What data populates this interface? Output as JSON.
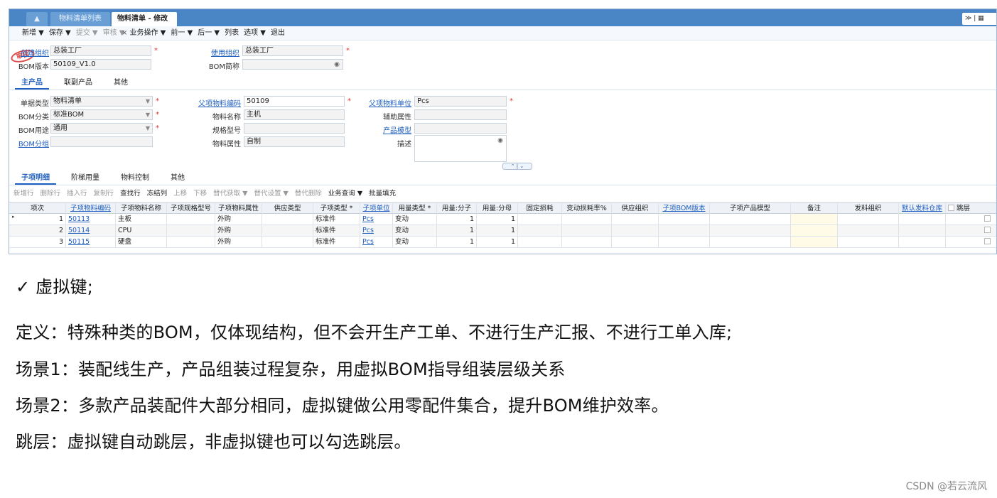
{
  "tabs": {
    "home_icon": "home-icon",
    "list": "物料清单列表",
    "active": "物料清单 - 修改",
    "close": "×",
    "right_tools": "≫ | ▦"
  },
  "toolbar": {
    "items": [
      {
        "label": "新增 ▼",
        "disabled": false
      },
      {
        "label": "保存 ▼",
        "disabled": false
      },
      {
        "label": "提交 ▼",
        "disabled": true
      },
      {
        "label": "审核 ▼",
        "disabled": true
      },
      {
        "label": "业务操作 ▼",
        "disabled": false
      },
      {
        "label": "前一 ▼",
        "disabled": false
      },
      {
        "label": "后一 ▼",
        "disabled": false
      },
      {
        "label": "列表",
        "disabled": false
      },
      {
        "label": "选项 ▼",
        "disabled": false
      },
      {
        "label": "退出",
        "disabled": false
      }
    ]
  },
  "header": {
    "stamp": "审核",
    "create_org_label": "创建组织",
    "create_org_value": "总装工厂",
    "use_org_label": "使用组织",
    "use_org_value": "总装工厂",
    "bom_version_label": "BOM版本",
    "bom_version_value": "50109_V1.0",
    "bom_short_label": "BOM简称",
    "bom_short_value": "",
    "required": "*"
  },
  "main_tabs": [
    "主产品",
    "联副产品",
    "其他"
  ],
  "form": {
    "doc_type_label": "单据类型",
    "doc_type_value": "物料清单",
    "bom_class_label": "BOM分类",
    "bom_class_value": "标准BOM",
    "bom_use_label": "BOM用途",
    "bom_use_value": "通用",
    "bom_group_label": "BOM分组",
    "bom_group_value": "",
    "parent_code_label": "父项物料编码",
    "parent_code_value": "50109",
    "material_name_label": "物料名称",
    "material_name_value": "主机",
    "spec_label": "规格型号",
    "spec_value": "",
    "material_attr_label": "物料属性",
    "material_attr_value": "自制",
    "parent_unit_label": "父项物料单位",
    "parent_unit_value": "Pcs",
    "aux_attr_label": "辅助属性",
    "aux_attr_value": "",
    "product_model_label": "产品模型",
    "product_model_value": "",
    "desc_label": "描述",
    "desc_value": "",
    "collapse": "⌃ | ⌄"
  },
  "detail_tabs": [
    "子项明细",
    "阶梯用量",
    "物料控制",
    "其他"
  ],
  "grid_toolbar": [
    {
      "label": "新增行",
      "disabled": true
    },
    {
      "label": "删除行",
      "disabled": true
    },
    {
      "label": "插入行",
      "disabled": true
    },
    {
      "label": "复制行",
      "disabled": true
    },
    {
      "label": "查找行",
      "disabled": false
    },
    {
      "label": "冻结列",
      "disabled": false
    },
    {
      "label": "上移",
      "disabled": true
    },
    {
      "label": "下移",
      "disabled": true
    },
    {
      "label": "替代获取 ▼",
      "disabled": true
    },
    {
      "label": "替代设置 ▼",
      "disabled": true
    },
    {
      "label": "替代删除",
      "disabled": true
    },
    {
      "label": "业务查询 ▼",
      "disabled": false
    },
    {
      "label": "批量填充",
      "disabled": false
    }
  ],
  "grid": {
    "columns": [
      "项次",
      "子项物料编码",
      "子项物料名称",
      "子项规格型号",
      "子项物料属性",
      "供应类型",
      "子项类型 *",
      "子项单位",
      "用量类型 *",
      "用量:分子",
      "用量:分母",
      "固定损耗",
      "变动损耗率%",
      "供应组织",
      "子项BOM版本",
      "子项产品模型",
      "备注",
      "发料组织",
      "默认发料仓库",
      "跳层"
    ],
    "rows": [
      [
        "1",
        "50113",
        "主板",
        "",
        "外购",
        "",
        "标准件",
        "Pcs",
        "变动",
        "1",
        "1"
      ],
      [
        "2",
        "50114",
        "CPU",
        "",
        "外购",
        "",
        "标准件",
        "Pcs",
        "变动",
        "1",
        "1"
      ],
      [
        "3",
        "50115",
        "硬盘",
        "",
        "外购",
        "",
        "标准件",
        "Pcs",
        "变动",
        "1",
        "1"
      ]
    ]
  },
  "notes": {
    "l1": "✓ 虚拟键;",
    "l2": "定义：特殊种类的BOM，仅体现结构，但不会开生产工单、不进行生产汇报、不进行工单入库;",
    "l3": "场景1：装配线生产，产品组装过程复杂，用虚拟BOM指导组装层级关系",
    "l4": "场景2：多款产品装配件大部分相同，虚拟键做公用零配件集合，提升BOM维护效率。",
    "l5": "跳层：虚拟键自动跳层，非虚拟键也可以勾选跳层。"
  },
  "watermark": "CSDN @若云流风",
  "colors": {
    "accent": "#4a86c5",
    "link": "#1f5fbf",
    "required": "#e0322b",
    "stamp": "#d83a35"
  }
}
